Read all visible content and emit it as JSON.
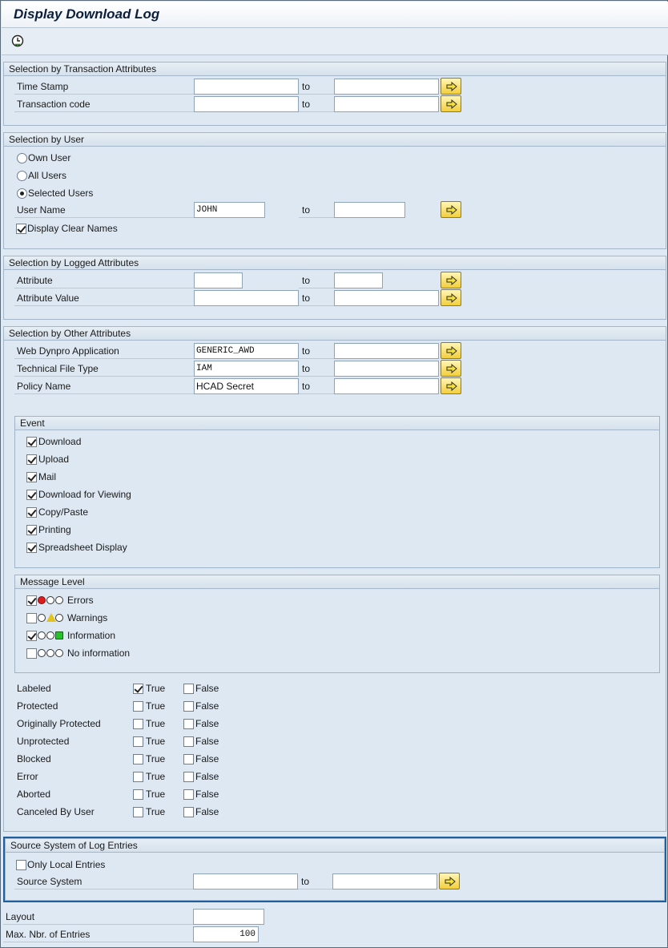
{
  "window": {
    "title": "Display Download Log"
  },
  "toolbar": {
    "execute_icon": "execute-clock-icon"
  },
  "common": {
    "to": "to"
  },
  "transaction": {
    "header": "Selection by Transaction Attributes",
    "time_stamp": {
      "label": "Time Stamp",
      "from": "",
      "to": ""
    },
    "transaction_code": {
      "label": "Transaction code",
      "from": "",
      "to": ""
    }
  },
  "user": {
    "header": "Selection by User",
    "radios": [
      {
        "label": "Own User",
        "selected": false
      },
      {
        "label": "All Users",
        "selected": false
      },
      {
        "label": "Selected Users",
        "selected": true
      }
    ],
    "user_name": {
      "label": "User Name",
      "from": "JOHN",
      "to": ""
    },
    "display_clear_names": {
      "label": "Display Clear Names",
      "checked": true
    }
  },
  "logged": {
    "header": "Selection by Logged Attributes",
    "attribute": {
      "label": "Attribute",
      "from": "",
      "to": ""
    },
    "attribute_value": {
      "label": "Attribute Value",
      "from": "",
      "to": ""
    }
  },
  "other": {
    "header": "Selection by Other Attributes",
    "web_dynpro": {
      "label": "Web Dynpro Application",
      "from": "GENERIC_AWD",
      "to": ""
    },
    "tech_file_type": {
      "label": "Technical File Type",
      "from": "IAM",
      "to": ""
    },
    "policy_name": {
      "label": "Policy Name",
      "from": "HCAD Secret",
      "to": ""
    }
  },
  "event": {
    "header": "Event",
    "items": [
      {
        "label": "Download",
        "checked": true
      },
      {
        "label": "Upload",
        "checked": true
      },
      {
        "label": "Mail",
        "checked": true
      },
      {
        "label": "Download for Viewing",
        "checked": true
      },
      {
        "label": "Copy/Paste",
        "checked": true
      },
      {
        "label": "Printing",
        "checked": true
      },
      {
        "label": "Spreadsheet Display",
        "checked": true
      }
    ]
  },
  "message_level": {
    "header": "Message Level",
    "items": [
      {
        "label": "Errors",
        "checked": true,
        "light": "red"
      },
      {
        "label": "Warnings",
        "checked": false,
        "light": "yellow"
      },
      {
        "label": "Information",
        "checked": true,
        "light": "green"
      },
      {
        "label": "No information",
        "checked": false,
        "light": "none"
      }
    ]
  },
  "flags": {
    "true_label": "True",
    "false_label": "False",
    "rows": [
      {
        "label": "Labeled",
        "true": true,
        "false": false
      },
      {
        "label": "Protected",
        "true": false,
        "false": false
      },
      {
        "label": "Originally Protected",
        "true": false,
        "false": false
      },
      {
        "label": "Unprotected",
        "true": false,
        "false": false
      },
      {
        "label": "Blocked",
        "true": false,
        "false": false
      },
      {
        "label": "Error",
        "true": false,
        "false": false
      },
      {
        "label": "Aborted",
        "true": false,
        "false": false
      },
      {
        "label": "Canceled By User",
        "true": false,
        "false": false
      }
    ]
  },
  "source": {
    "header": "Source System of Log Entries",
    "only_local": {
      "label": "Only Local Entries",
      "checked": false
    },
    "source_system": {
      "label": "Source System",
      "from": "",
      "to": ""
    }
  },
  "bottom": {
    "layout": {
      "label": "Layout",
      "value": ""
    },
    "max_entries": {
      "label": "Max. Nbr. of Entries",
      "value": "100"
    }
  },
  "colors": {
    "background": "#dfe9f3",
    "multi_button": "#f2cf3a",
    "highlight_border": "#1f5f9f"
  }
}
